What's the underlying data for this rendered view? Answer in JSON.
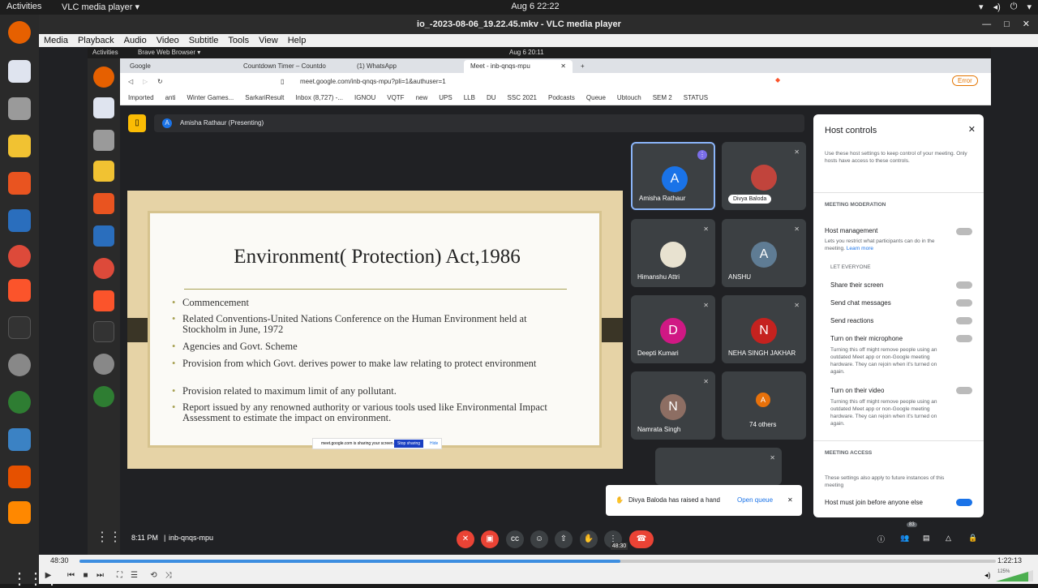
{
  "topbar": {
    "activities": "Activities",
    "app": "VLC media player ▾",
    "clock": "Aug 6  22:22"
  },
  "vlc": {
    "title": "io_-2023-08-06_19.22.45.mkv - VLC media player",
    "menu": [
      "Media",
      "Playback",
      "Audio",
      "Video",
      "Subtitle",
      "Tools",
      "View",
      "Help"
    ],
    "time_elapsed": "48:30",
    "time_total": "1:22:13",
    "seek_tooltip": "48:30",
    "progress": 0.59,
    "volume": "125%"
  },
  "inner_topbar": {
    "activities": "Activities",
    "app": "Brave Web Browser ▾",
    "clock": "Aug 6  20:11"
  },
  "browser": {
    "tabs": [
      {
        "label": "Google"
      },
      {
        "label": "Countdown Timer – Countdo"
      },
      {
        "label": "(1) WhatsApp"
      },
      {
        "label": "Meet - inb-qnqs-mpu"
      }
    ],
    "new_tab": "+",
    "url": "meet.google.com/inb-qnqs-mpu?pli=1&authuser=1",
    "error_label": "Error",
    "bookmarks": [
      "Imported",
      "anti",
      "Winter Games...",
      "SarkariResult",
      "Inbox (8,727) -...",
      "IGNOU",
      "VQTF",
      "new",
      "UPS",
      "LLB",
      "DU",
      "SSC 2021",
      "Podcasts",
      "Queue",
      "Ubtouch",
      "SEM 2",
      "STATUS"
    ]
  },
  "meet": {
    "presenter": "Amisha Rathaur (Presenting)",
    "presenter_initial": "A",
    "slide": {
      "title": "Environment( Protection) Act,1986",
      "bullets": [
        "Commencement",
        "Related Conventions-United Nations Conference on the Human Environment held at Stockholm in June, 1972",
        "Agencies and Govt. Scheme",
        "Provision from which Govt. derives power to make law relating to protect environment",
        "Provision related to maximum limit of any pollutant.",
        "Report issued by any renowned authority or various tools used like Environmental Impact Assessment to estimate the impact on environment."
      ],
      "share_bar_text": "meet.google.com is sharing your screen.",
      "share_stop": "Stop sharing",
      "share_hide": "Hide"
    },
    "participants": [
      {
        "name": "Amisha Rathaur",
        "initial": "A",
        "color": "#1a73e8"
      },
      {
        "name": "Divya Baloda",
        "initial": "",
        "color": "#c1443c"
      },
      {
        "name": "Himanshu Attri",
        "initial": "",
        "color": "#e8e2d0"
      },
      {
        "name": "ANSHU",
        "initial": "A",
        "color": "#5f7c94"
      },
      {
        "name": "Deepti Kumari",
        "initial": "D",
        "color": "#d01884"
      },
      {
        "name": "NEHA SINGH JAKHAR",
        "initial": "N",
        "color": "#c5221f"
      },
      {
        "name": "Namrata Singh",
        "initial": "N",
        "color": "#8d6e63"
      },
      {
        "name": "74 others",
        "initial": "A",
        "color": "#e8710a"
      }
    ],
    "host_controls": {
      "title": "Host controls",
      "desc": "Use these host settings to keep control of your meeting. Only hosts have access to these controls.",
      "moderation_header": "MEETING MODERATION",
      "host_management": "Host management",
      "host_management_desc": "Lets you restrict what participants can do in the meeting.",
      "learn_more": "Learn more",
      "let_everyone": "LET EVERYONE",
      "share_screen": "Share their screen",
      "send_chat": "Send chat messages",
      "send_reactions": "Send reactions",
      "mic": "Turn on their microphone",
      "mic_desc": "Turning this off might remove people using an outdated Meet app or non-Google meeting hardware. They can rejoin when it's turned on again.",
      "video": "Turn on their video",
      "video_desc": "Turning this off might remove people using an outdated Meet app or non-Google meeting hardware. They can rejoin when it's turned on again.",
      "access_header": "MEETING ACCESS",
      "access_desc": "These settings also apply to future instances of this meeting",
      "join_before": "Host must join before anyone else"
    },
    "toast": {
      "text": "Divya Baloda has raised a hand",
      "action": "Open queue"
    },
    "bottom": {
      "time": "8:11 PM",
      "code": "inb-qnqs-mpu",
      "people_count": "83"
    }
  }
}
